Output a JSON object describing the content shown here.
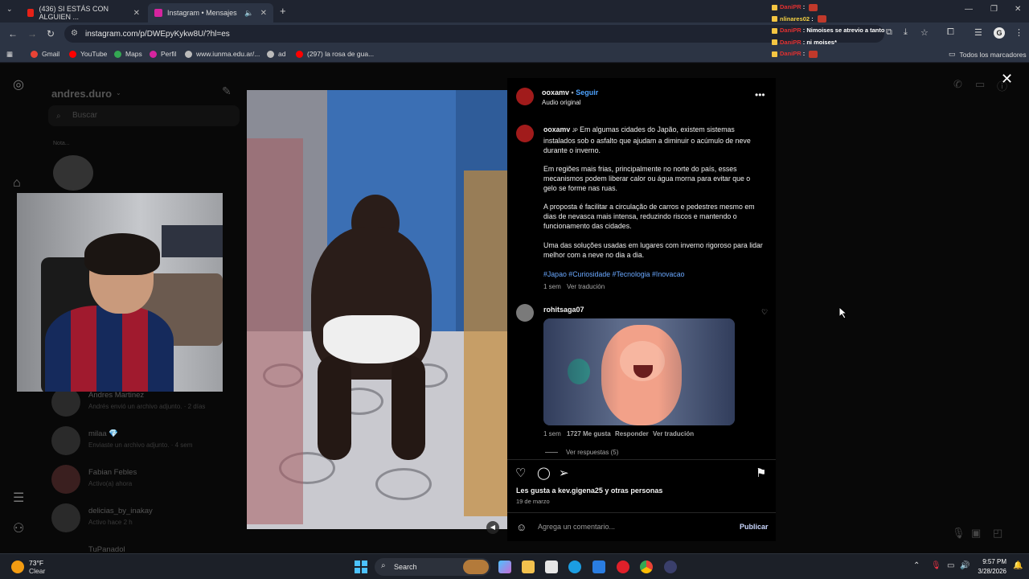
{
  "browser": {
    "tabs": [
      {
        "title": "(436) SI ESTÁS CON ALGUIEN ...",
        "active": false
      },
      {
        "title": "Instagram • Mensajes",
        "active": true
      }
    ],
    "new_tab": "+",
    "url": "instagram.com/p/DWEpyKykw8U/?hl=es",
    "bookmarks": [
      "Gmail",
      "YouTube",
      "Maps",
      "Perfil",
      "www.iunma.edu.ar/...",
      "ad",
      "(297) la rosa de gua...",
      "Todos los marcadores"
    ]
  },
  "chat_overlay": [
    {
      "user": "DaniPR",
      "msg": ""
    },
    {
      "user": "nlinares02",
      "msg": ""
    },
    {
      "user": "DaniPR",
      "msg": "Nimoises se atrevio a tanto"
    },
    {
      "user": "DaniPR",
      "msg": "ni moises*"
    },
    {
      "user": "DaniPR",
      "msg": ""
    }
  ],
  "dm": {
    "username": "andres.duro",
    "search_placeholder": "Buscar",
    "note": "Nota...",
    "items": [
      {
        "name": "Andres Martinez",
        "sub": "Andrés envió un archivo adjunto. · 2 días"
      },
      {
        "name": "milaa 💎",
        "sub": "Enviaste un archivo adjunto. · 4 sem"
      },
      {
        "name": "Fabian Febles",
        "sub": "Activo(a) ahora"
      },
      {
        "name": "delicias_by_inakay",
        "sub": "Activo hace 2 h"
      },
      {
        "name": "TuPanadol",
        "sub": ""
      }
    ]
  },
  "post": {
    "author": "ooxamv",
    "follow": "Seguir",
    "audio": "Audio original",
    "caption_author": "ooxamv",
    "caption_flag": "JP",
    "caption_p1": "Em algumas cidades do Japão, existem sistemas instalados sob o asfalto que ajudam a diminuir o acúmulo de neve durante o inverno.",
    "caption_p2": "Em regiões mais frias, principalmente no norte do país, esses mecanismos podem liberar calor ou água morna para evitar que o gelo se forme nas ruas.",
    "caption_p3": "A proposta é facilitar a circulação de carros e pedestres mesmo em dias de nevasca mais intensa, reduzindo riscos e mantendo o funcionamento das cidades.",
    "caption_p4": "Uma das soluções usadas em lugares com inverno rigoroso para lidar melhor com a neve no dia a dia.",
    "hashtags": "#Japao #Curiosidade #Tecnologia #Inovacao",
    "caption_time": "1 sem",
    "see_translation": "Ver tradución",
    "comment": {
      "user": "rohitsaga07",
      "time": "1 sem",
      "likes": "1727 Me gusta",
      "reply": "Responder",
      "translate": "Ver tradución",
      "replies": "Ver respuestas (5)"
    },
    "likes_line": "Les gusta a kev.gigena25 y otras personas",
    "date": "19 de marzo",
    "comment_placeholder": "Agrega un comentario...",
    "publish": "Publicar"
  },
  "taskbar": {
    "temp": "73°F",
    "condition": "Clear",
    "search": "Search",
    "time": "9:57 PM",
    "date": "3/28/2026"
  }
}
